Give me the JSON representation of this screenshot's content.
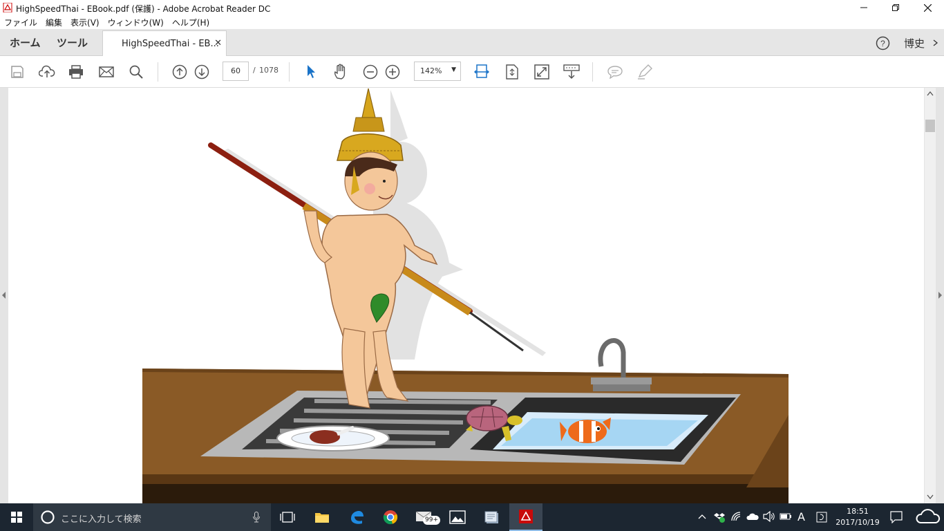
{
  "window": {
    "title": "HighSpeedThai - EBook.pdf (保護) - Adobe Acrobat Reader DC",
    "minimize_icon": "minimize-icon",
    "restore_icon": "restore-icon",
    "close_icon": "close-icon"
  },
  "menu": [
    "ファイル",
    "編集",
    "表示(V)",
    "ウィンドウ(W)",
    "ヘルプ(H)"
  ],
  "tabs": {
    "home": "ホーム",
    "tools": "ツール",
    "document": "HighSpeedThai - EB...",
    "user": "博史"
  },
  "toolbar": {
    "page_current": "60",
    "page_separator": "/",
    "page_total": "1078",
    "zoom": "142%",
    "icons": [
      "save-icon",
      "cloud-upload-icon",
      "print-icon",
      "email-icon",
      "search-icon",
      "page-up-icon",
      "page-down-icon",
      "select-arrow-icon",
      "hand-tool-icon",
      "zoom-out-icon",
      "zoom-in-icon",
      "fit-width-icon",
      "fit-page-icon",
      "full-screen-icon",
      "read-mode-icon",
      "comment-icon",
      "highlight-icon"
    ]
  },
  "document": {
    "illustration": "Cartoon boy wearing Thai crown holding a fishing spear, standing on a kitchen sink counter with a plate of food, a turtle and a clownfish in the water basin"
  },
  "taskbar": {
    "search_placeholder": "ここに入力して検索",
    "mail_badge": "99+",
    "ime_indicator": "A",
    "time": "18:51",
    "date": "2017/10/19"
  },
  "colors": {
    "accent": "#1a73c8",
    "tab_bg": "#e6e6e6",
    "taskbar_bg": "#1c2631",
    "counter_wood": "#8a5a26"
  }
}
